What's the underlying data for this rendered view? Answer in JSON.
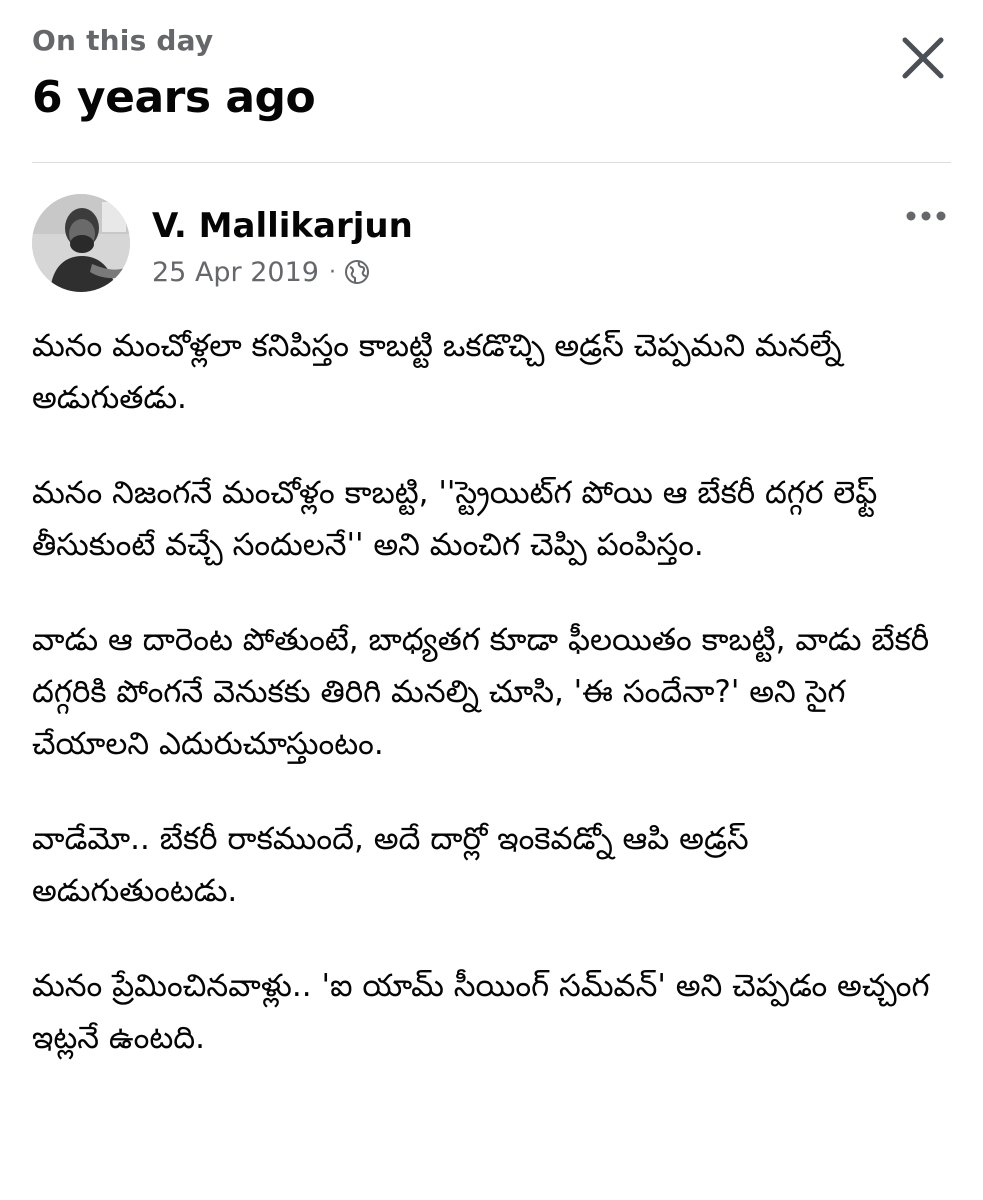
{
  "header": {
    "eyebrow": "On this day",
    "title": "6 years ago",
    "close_icon": "close-icon"
  },
  "post": {
    "author": "V. Mallikarjun",
    "date": "25 Apr 2019",
    "separator": "·",
    "privacy_icon": "globe-icon",
    "more_icon": "more-options-icon",
    "paragraphs": [
      "మనం మంచోళ్లలా కనిపిస్తం కాబట్టి ఒకడొచ్చి అడ్రస్ చెప్పమని మనల్నే అడుగుతడు.",
      "మనం నిజంగనే మంచోళ్లం కాబట్టి, ''స్ట్రెయిట్‌గ పోయి ఆ బేకరీ దగ్గర లెఫ్ట్ తీసుకుంటే వచ్చే సందులనే'' అని మంచిగ చెప్పి పంపిస్తం.",
      "వాడు ఆ దారెంట పోతుంటే, బాధ్యతగ కూడా ఫీలయితం కాబట్టి, వాడు బేకరీ దగ్గరికి పోంగనే వెనుకకు తిరిగి మనల్ని చూసి, 'ఈ సందేనా?' అని సైగ చేయాలని ఎదురుచూస్తుంటం.",
      "వాడేమో.. బేకరీ రాకముందే, అదే దార్లో ఇంకెవడ్నో ఆపి అడ్రస్ అడుగుతుంటడు.",
      "మనం ప్రేమించినవాళ్లు.. 'ఐ యామ్ సీయింగ్ సమ్‌వన్' అని చెప్పడం అచ్చంగ ఇట్లనే ఉంటది."
    ]
  },
  "colors": {
    "primary_text": "#050505",
    "secondary_text": "#65676b",
    "divider": "#dadde1",
    "background": "#ffffff"
  }
}
